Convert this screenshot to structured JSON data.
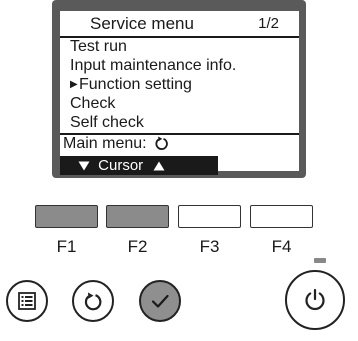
{
  "screen": {
    "title": "Service menu",
    "page": "1/2",
    "menu_items": [
      {
        "label": "Test run",
        "selected": false
      },
      {
        "label": "Input maintenance info.",
        "selected": false
      },
      {
        "label": "Function setting",
        "selected": true
      },
      {
        "label": "Check",
        "selected": false
      },
      {
        "label": "Self check",
        "selected": false
      }
    ],
    "main_menu_label": "Main menu:",
    "cursor_label": "Cursor",
    "selection_marker": "▶"
  },
  "function_buttons": [
    {
      "label": "F1",
      "state": "pressed"
    },
    {
      "label": "F2",
      "state": "pressed"
    },
    {
      "label": "F3",
      "state": "idle"
    },
    {
      "label": "F4",
      "state": "idle"
    }
  ],
  "round_buttons": [
    {
      "icon": "menu-icon",
      "state": "idle"
    },
    {
      "icon": "return-icon",
      "state": "idle"
    },
    {
      "icon": "checkmark-icon",
      "state": "pressed"
    },
    {
      "icon": "power-icon",
      "state": "idle"
    }
  ],
  "colors": {
    "lcd_bezel": "#5a5a5a",
    "pressed_button": "#8b8b8b",
    "cursor_bar": "#1a1a1a"
  }
}
